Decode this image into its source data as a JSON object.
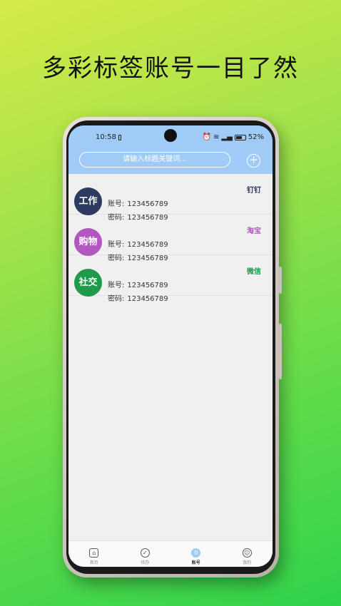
{
  "headline": "多彩标签账号一目了然",
  "status_bar": {
    "time": "10:58",
    "battery": "52%"
  },
  "search": {
    "placeholder": "请输入标题关键词..."
  },
  "add_button": "+",
  "accounts": [
    {
      "avatar_text": "工作",
      "avatar_color": "#2e3a5f",
      "tag": "钉钉",
      "tag_color": "#2e3a5f",
      "account_label": "账号:",
      "account_value": "123456789",
      "password_label": "密码:",
      "password_value": "123456789"
    },
    {
      "avatar_text": "购物",
      "avatar_color": "#b256c0",
      "tag": "淘宝",
      "tag_color": "#b256c0",
      "account_label": "账号:",
      "account_value": "123456789",
      "password_label": "密码:",
      "password_value": "123456789"
    },
    {
      "avatar_text": "社交",
      "avatar_color": "#1f9a4c",
      "tag": "微信",
      "tag_color": "#1f9a4c",
      "account_label": "账号:",
      "account_value": "123456789",
      "password_label": "密码:",
      "password_value": "123456789"
    }
  ],
  "bottom_nav": [
    {
      "label": "首页",
      "icon": "home-icon",
      "active": false
    },
    {
      "label": "待办",
      "icon": "check-circle-icon",
      "active": false
    },
    {
      "label": "账号",
      "icon": "account-icon",
      "active": true
    },
    {
      "label": "我的",
      "icon": "user-icon",
      "active": false
    }
  ]
}
